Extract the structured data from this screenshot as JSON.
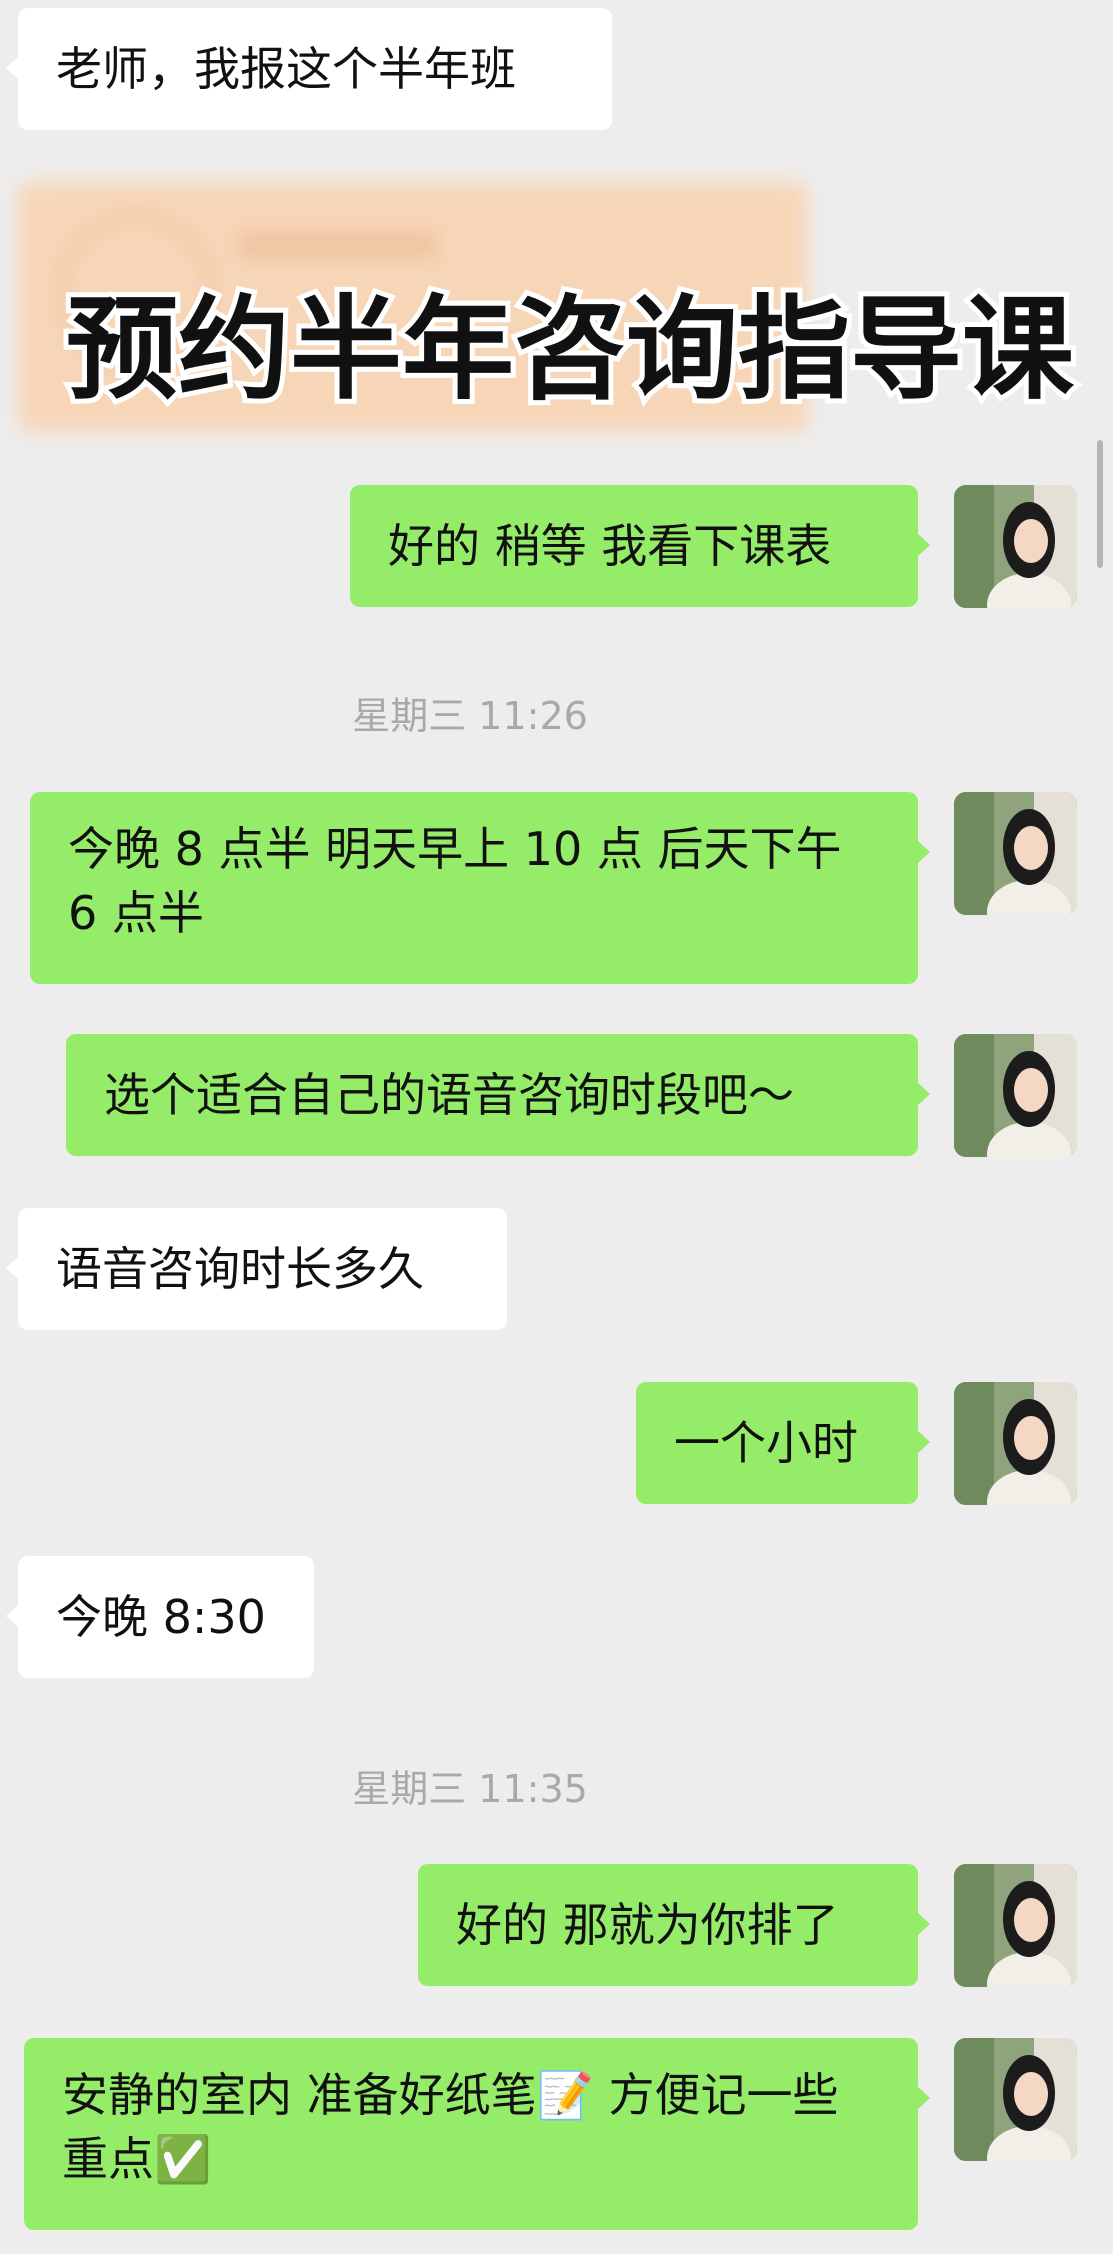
{
  "overlay": {
    "title": "预约半年咨询指导课"
  },
  "messages": [
    {
      "side": "in",
      "text": "老师，我报这个半年班"
    },
    {
      "side": "out",
      "text": "好的 稍等 我看下课表"
    },
    {
      "type": "time",
      "text": "星期三 11:26"
    },
    {
      "side": "out",
      "text": "今晚 8 点半 明天早上 10 点 后天下午 6 点半"
    },
    {
      "side": "out",
      "text": "选个适合自己的语音咨询时段吧～"
    },
    {
      "side": "in",
      "text": "语音咨询时长多久"
    },
    {
      "side": "out",
      "text": "一个小时"
    },
    {
      "side": "in",
      "text": "今晚 8:30"
    },
    {
      "type": "time",
      "text": "星期三 11:35"
    },
    {
      "side": "out",
      "text": "好的 那就为你排了"
    },
    {
      "side": "out",
      "text": "安静的室内 准备好纸笔📝 方便记一些重点✅"
    }
  ],
  "colors": {
    "background": "#ededed",
    "outgoing_bubble": "#95ec69",
    "incoming_bubble": "#ffffff",
    "timestamp": "#a9a9a9"
  },
  "icons": {
    "avatar": "user-avatar-photo",
    "memo": "memo-emoji",
    "check": "check-mark-emoji"
  }
}
